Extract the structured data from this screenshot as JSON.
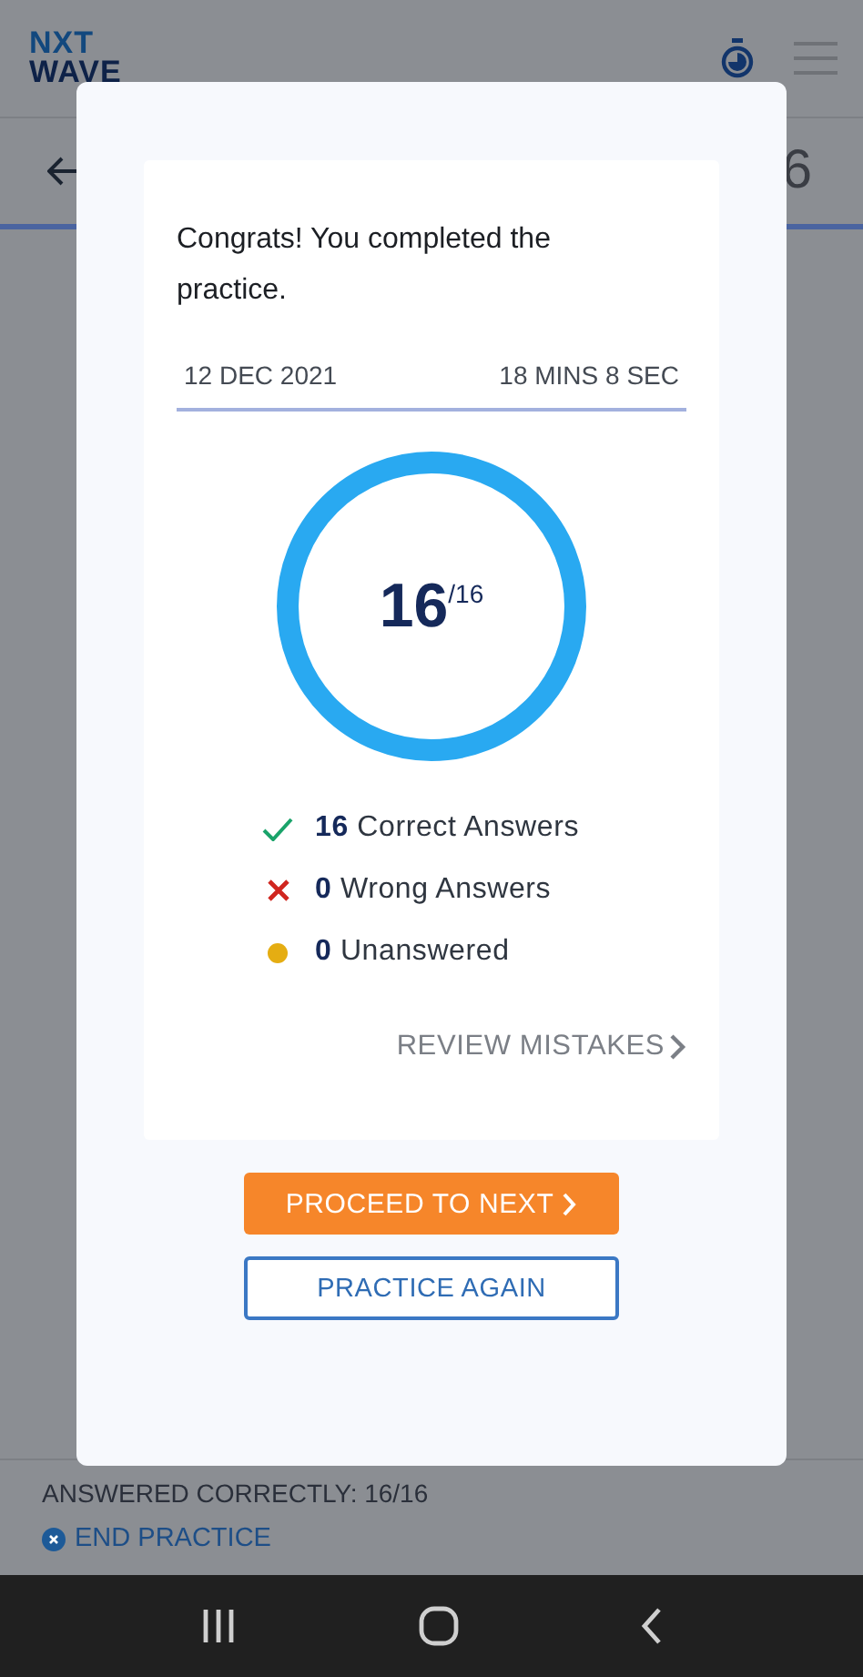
{
  "header": {
    "logo_lines": [
      "NXT",
      "WAVE"
    ]
  },
  "subheader": {
    "score_fragment": "6"
  },
  "footer": {
    "answered": "ANSWERED CORRECTLY: 16/16",
    "end_label": "END PRACTICE"
  },
  "modal": {
    "message": "Congrats! You completed the practice.",
    "date": "12 DEC 2021",
    "duration": "18 MINS 8 SEC",
    "score": {
      "value": "16",
      "total": "/16",
      "level": 1
    },
    "stats": [
      {
        "kind": "correct",
        "count": "16",
        "label": "Correct Answers"
      },
      {
        "kind": "wrong",
        "count": "0",
        "label": "Wrong Answers"
      },
      {
        "kind": "unanswered",
        "count": "0",
        "label": "Unanswered"
      }
    ],
    "review_link": "REVIEW MISTAKES",
    "primary_button": "PROCEED TO NEXT",
    "secondary_button": "PRACTICE AGAIN"
  }
}
